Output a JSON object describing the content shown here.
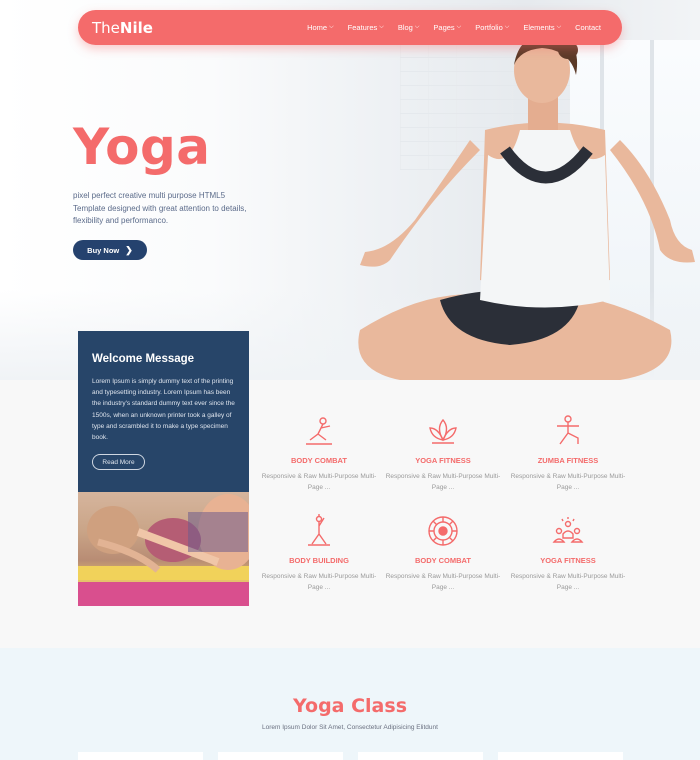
{
  "nav": {
    "logo_light": "The",
    "logo_bold": "Nile",
    "items": [
      {
        "label": "Home",
        "dropdown": true
      },
      {
        "label": "Features",
        "dropdown": true
      },
      {
        "label": "Blog",
        "dropdown": true
      },
      {
        "label": "Pages",
        "dropdown": true
      },
      {
        "label": "Portfolio",
        "dropdown": true
      },
      {
        "label": "Elements",
        "dropdown": true
      },
      {
        "label": "Contact",
        "dropdown": false
      }
    ]
  },
  "hero": {
    "title": "Yoga",
    "description": "pixel perfect creative multi purpose HTML5 Template designed with great attention to details, flexibility and performanco.",
    "button_label": "Buy Now"
  },
  "welcome": {
    "title": "Welcome Message",
    "text": "Lorem Ipsum is simply dummy text of the printing and typesetting industry. Lorem Ipsum has been the industry's standard dummy text ever since the 1500s, when an unknown printer took a galley of type and scrambled it to make a type specimen book.",
    "button_label": "Read More"
  },
  "features": [
    {
      "title": "BODY COMBAT",
      "desc": "Responsive & Raw Multi-Purpose Multi-Page ...",
      "icon": "yoga-pose-icon"
    },
    {
      "title": "YOGA FITNESS",
      "desc": "Responsive & Raw Multi-Purpose Multi-Page ...",
      "icon": "lotus-icon"
    },
    {
      "title": "ZUMBA FITNESS",
      "desc": "Responsive & Raw Multi-Purpose Multi-Page ...",
      "icon": "warrior-pose-icon"
    },
    {
      "title": "BODY BUILDING",
      "desc": "Responsive & Raw Multi-Purpose Multi-Page ...",
      "icon": "stretch-pose-icon"
    },
    {
      "title": "BODY COMBAT",
      "desc": "Responsive & Raw Multi-Purpose Multi-Page ...",
      "icon": "mandala-icon"
    },
    {
      "title": "YOGA FITNESS",
      "desc": "Responsive & Raw Multi-Purpose Multi-Page ...",
      "icon": "group-meditation-icon"
    }
  ],
  "yoga_class": {
    "title": "Yoga Class",
    "subtitle": "Lorem Ipsum Dolor Sit Amet, Consectetur Adipisicing Elitdunt"
  },
  "colors": {
    "accent": "#f46b6b",
    "navy": "#274569",
    "button_navy": "#25426e"
  }
}
